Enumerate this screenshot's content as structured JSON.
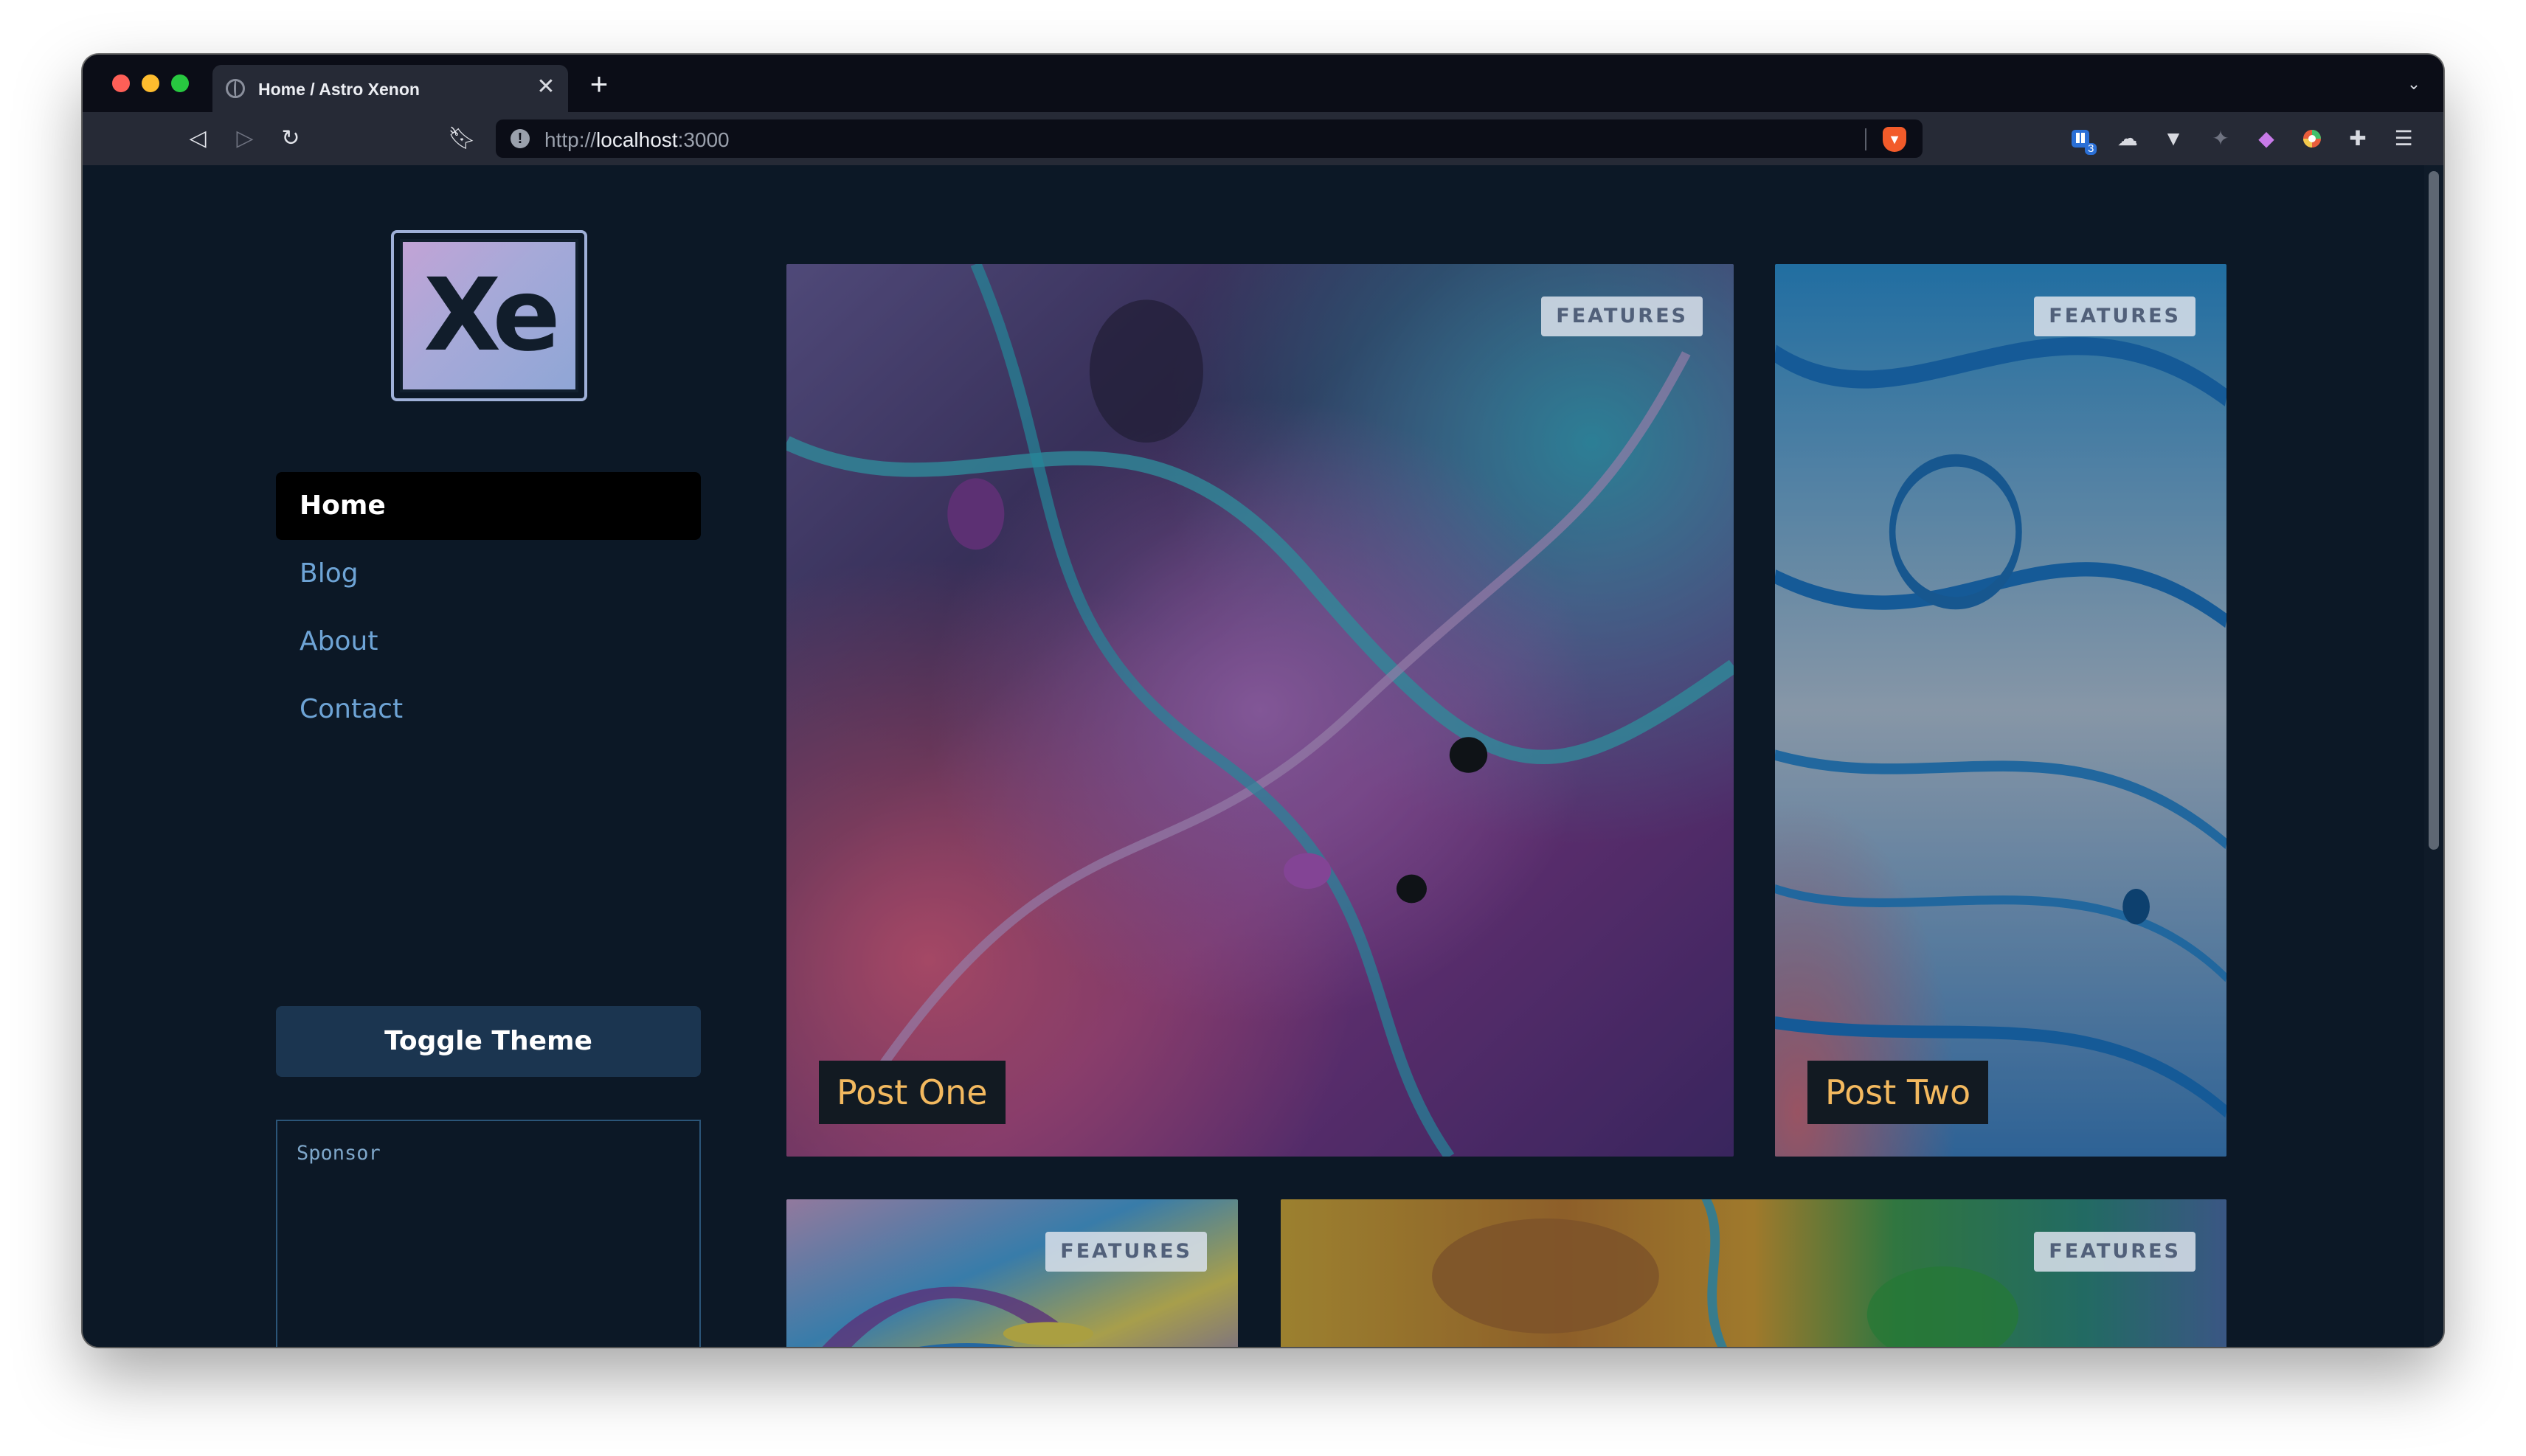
{
  "browser": {
    "tab_title": "Home / Astro Xenon",
    "tab_close": "✕",
    "new_tab": "+",
    "url_scheme": "http://",
    "url_host": "localhost",
    "url_port": ":3000",
    "extension_badge": "3"
  },
  "sidebar": {
    "logo_text": "Xe",
    "nav": [
      {
        "label": "Home",
        "active": true
      },
      {
        "label": "Blog",
        "active": false
      },
      {
        "label": "About",
        "active": false
      },
      {
        "label": "Contact",
        "active": false
      }
    ],
    "toggle_theme_label": "Toggle Theme",
    "sponsor_label": "Sponsor"
  },
  "posts": [
    {
      "title": "Post One",
      "badge": "FEATURES"
    },
    {
      "title": "Post Two",
      "badge": "FEATURES"
    },
    {
      "title": "",
      "badge": "FEATURES"
    },
    {
      "title": "",
      "badge": "FEATURES"
    }
  ],
  "colors": {
    "page_bg": "#0c1826",
    "accent_title": "#f3b95f",
    "nav_link": "#6ea4d6",
    "toggle_bg": "#1b3550"
  },
  "icons": [
    "back-icon",
    "forward-icon",
    "reload-icon",
    "bookmark-icon",
    "info-icon",
    "brave-shield-icon",
    "extension-icon",
    "menu-icon",
    "globe-icon",
    "close-icon",
    "plus-icon",
    "chevron-down-icon"
  ]
}
